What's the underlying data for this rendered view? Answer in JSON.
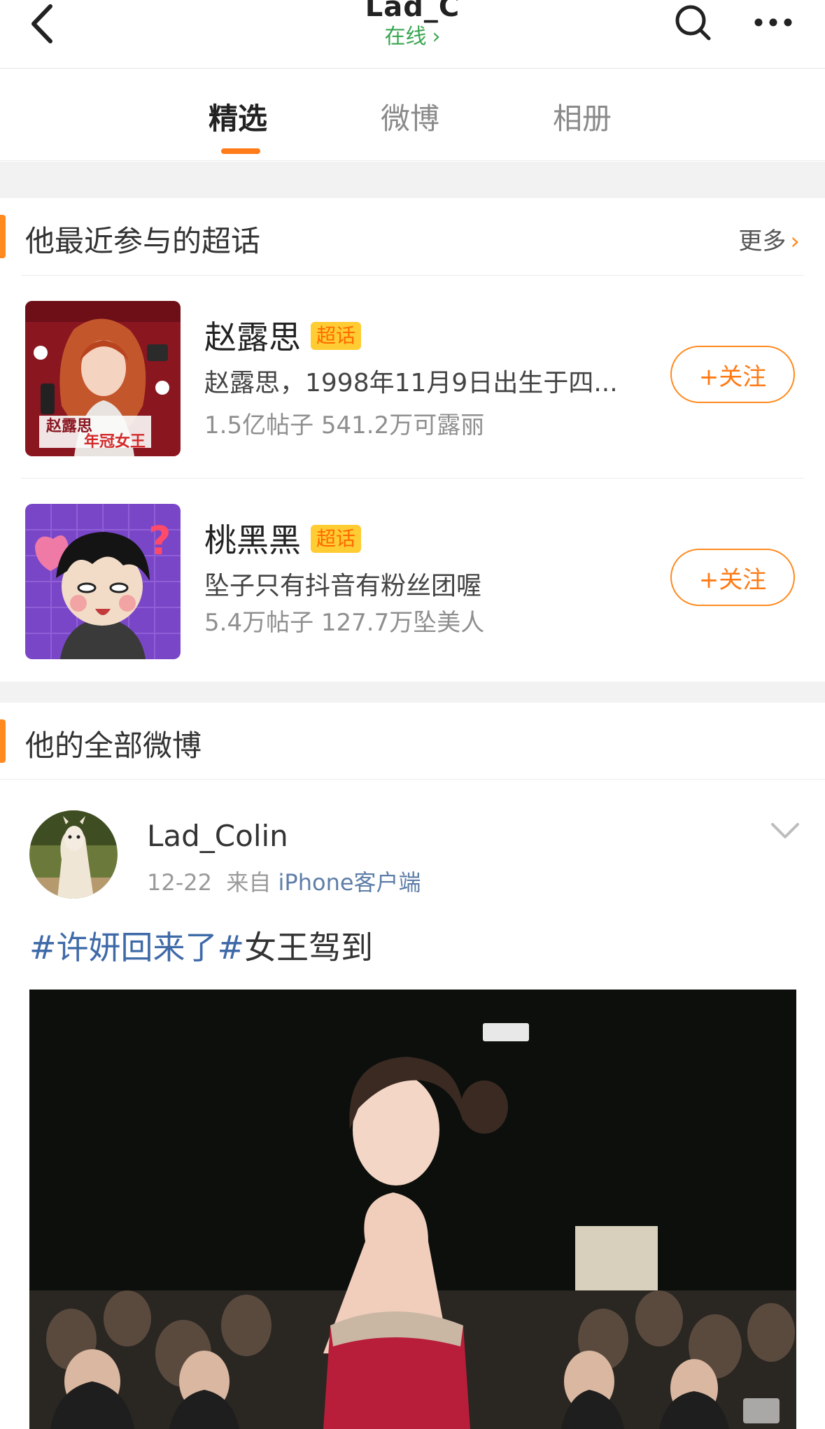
{
  "header": {
    "title": "Lad_C",
    "status": "在线"
  },
  "tabs": [
    {
      "label": "精选",
      "active": true
    },
    {
      "label": "微博",
      "active": false
    },
    {
      "label": "相册",
      "active": false
    }
  ],
  "supertopics": {
    "section_title": "他最近参与的超话",
    "more_label": "更多",
    "items": [
      {
        "name": "赵露思",
        "badge": "超话",
        "description": "赵露思，1998年11月9日出生于四...",
        "stats": "1.5亿帖子 541.2万可露丽",
        "follow_label": "+关注",
        "thumb_text_1": "赵露思",
        "thumb_text_2": "年冠女王"
      },
      {
        "name": "桃黑黑",
        "badge": "超话",
        "description": "坠子只有抖音有粉丝团喔",
        "stats": "5.4万帖子 127.7万坠美人",
        "follow_label": "+关注"
      }
    ]
  },
  "feed": {
    "section_title": "他的全部微博",
    "post": {
      "username": "Lad_Colin",
      "date": "12-22",
      "from_prefix": "来自",
      "source": "iPhone客户端",
      "hashtag": "#许妍回来了#",
      "text": "女王驾到"
    }
  },
  "colors": {
    "accent": "#ff8a1f",
    "online": "#3aa651",
    "link": "#3f6aa8"
  }
}
